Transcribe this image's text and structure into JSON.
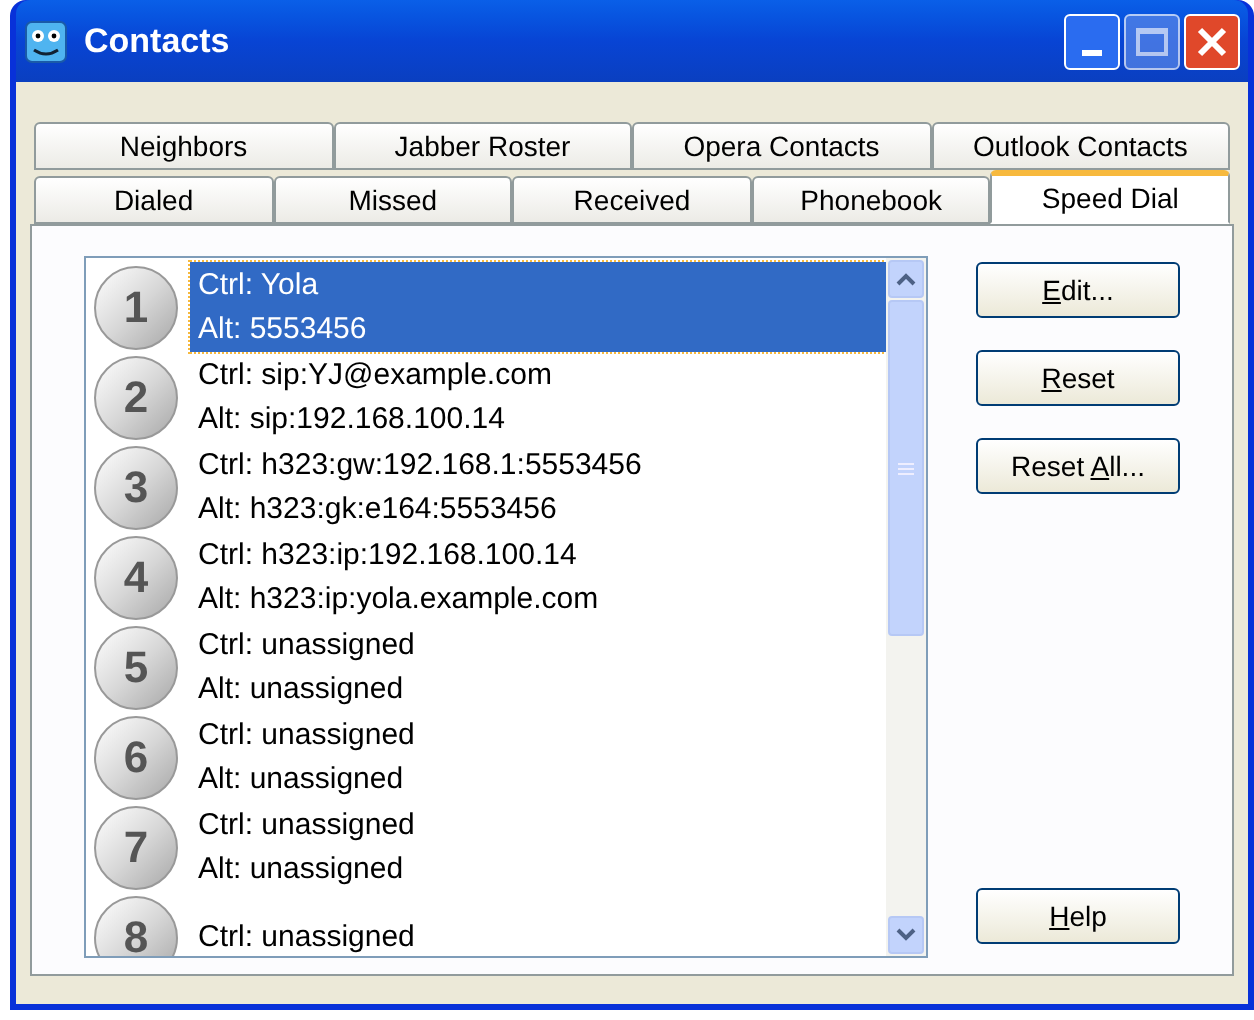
{
  "window": {
    "title": "Contacts"
  },
  "tab_rows": [
    [
      {
        "label": "Neighbors",
        "selected": false
      },
      {
        "label": "Jabber Roster",
        "selected": false
      },
      {
        "label": "Opera Contacts",
        "selected": false
      },
      {
        "label": "Outlook Contacts",
        "selected": false
      }
    ],
    [
      {
        "label": "Dialed",
        "selected": false
      },
      {
        "label": "Missed",
        "selected": false
      },
      {
        "label": "Received",
        "selected": false
      },
      {
        "label": "Phonebook",
        "selected": false
      },
      {
        "label": "Speed Dial",
        "selected": true
      }
    ]
  ],
  "speed_dial": [
    {
      "number": "1",
      "ctrl": "Ctrl: Yola",
      "alt": "Alt: 5553456",
      "selected": true
    },
    {
      "number": "2",
      "ctrl": "Ctrl: sip:YJ@example.com",
      "alt": "Alt: sip:192.168.100.14",
      "selected": false
    },
    {
      "number": "3",
      "ctrl": "Ctrl: h323:gw:192.168.1:5553456",
      "alt": "Alt: h323:gk:e164:5553456",
      "selected": false
    },
    {
      "number": "4",
      "ctrl": "Ctrl: h323:ip:192.168.100.14",
      "alt": "Alt: h323:ip:yola.example.com",
      "selected": false
    },
    {
      "number": "5",
      "ctrl": "Ctrl: unassigned",
      "alt": "Alt: unassigned",
      "selected": false
    },
    {
      "number": "6",
      "ctrl": "Ctrl: unassigned",
      "alt": "Alt: unassigned",
      "selected": false
    },
    {
      "number": "7",
      "ctrl": "Ctrl: unassigned",
      "alt": "Alt: unassigned",
      "selected": false
    },
    {
      "number": "8",
      "ctrl": "Ctrl: unassigned",
      "selected": false
    }
  ],
  "buttons": [
    {
      "key": "E",
      "after": "dit..."
    },
    {
      "key": "R",
      "after": "eset"
    },
    {
      "before": "Reset ",
      "key": "A",
      "after": "ll..."
    }
  ],
  "help_button": {
    "key": "H",
    "after": "elp"
  }
}
